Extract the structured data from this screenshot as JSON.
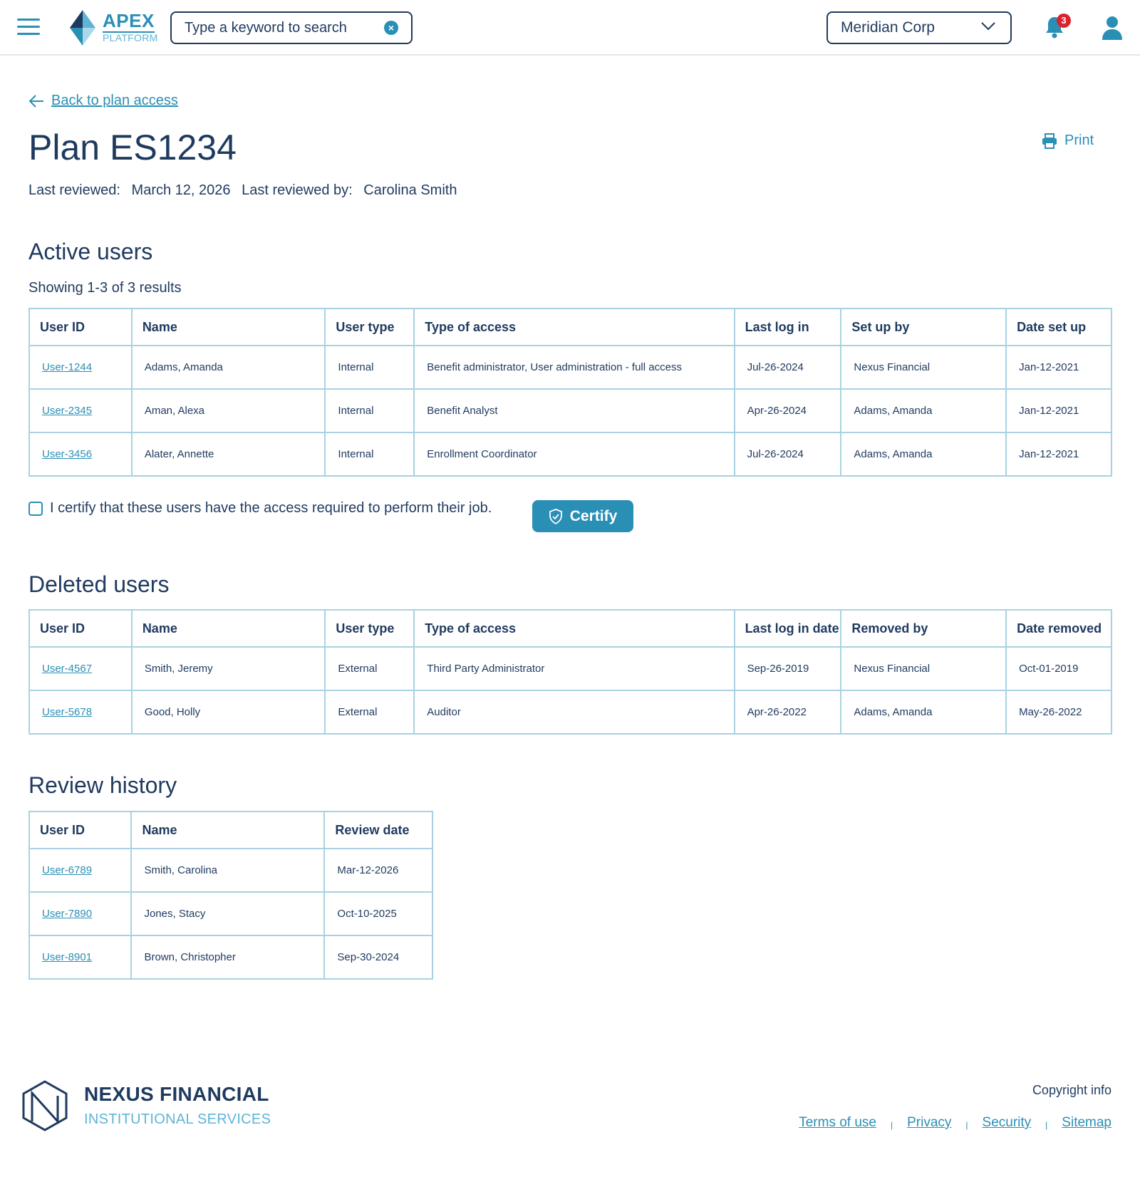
{
  "header": {
    "logo_word": "APEX",
    "logo_sub": "PLATFORM",
    "search_placeholder": "Type a keyword to search",
    "org_selected": "Meridian Corp",
    "notification_count": "3"
  },
  "page": {
    "back_label": "Back to plan access",
    "title": "Plan ES1234",
    "print_label": "Print",
    "last_reviewed_label": "Last reviewed:",
    "last_reviewed_value": "March 12, 2026",
    "last_reviewed_by_label": "Last reviewed by:",
    "last_reviewed_by_value": "Carolina Smith"
  },
  "active_users": {
    "title": "Active users",
    "results": "Showing 1-3 of 3 results",
    "columns": [
      "User ID",
      "Name",
      "User type",
      "Type of access",
      "Last log in",
      "Set up by",
      "Date set up"
    ],
    "rows": [
      [
        "User-1244",
        "Adams, Amanda",
        "Internal",
        "Benefit administrator, User administration - full access",
        "Jul-26-2024",
        "Nexus Financial",
        "Jan-12-2021"
      ],
      [
        "User-2345",
        "Aman, Alexa",
        "Internal",
        "Benefit Analyst",
        "Apr-26-2024",
        "Adams, Amanda",
        "Jan-12-2021"
      ],
      [
        "User-3456",
        "Alater, Annette",
        "Internal",
        "Enrollment Coordinator",
        "Jul-26-2024",
        "Adams, Amanda",
        "Jan-12-2021"
      ]
    ],
    "certify_text": "I certify that these users have the access required to perform their job.",
    "certify_button": "Certify"
  },
  "deleted_users": {
    "title": "Deleted users",
    "columns": [
      "User ID",
      "Name",
      "User type",
      "Type of access",
      "Last log in date",
      "Removed by",
      "Date removed"
    ],
    "rows": [
      [
        "User-4567",
        "Smith, Jeremy",
        "External",
        "Third Party Administrator",
        "Sep-26-2019",
        "Nexus Financial",
        "Oct-01-2019"
      ],
      [
        "User-5678",
        "Good, Holly",
        "External",
        "Auditor",
        "Apr-26-2022",
        "Adams, Amanda",
        "May-26-2022"
      ]
    ]
  },
  "review_history": {
    "title": "Review history",
    "columns": [
      "User ID",
      "Name",
      "Review date"
    ],
    "rows": [
      [
        "User-6789",
        "Smith, Carolina",
        "Mar-12-2026"
      ],
      [
        "User-7890",
        "Jones, Stacy",
        "Oct-10-2025"
      ],
      [
        "User-8901",
        "Brown, Christopher",
        "Sep-30-2024"
      ]
    ]
  },
  "footer": {
    "name": "NEXUS FINANCIAL",
    "sub": "INSTITUTIONAL SERVICES",
    "copyright": "Copyright info",
    "links": [
      "Terms of use",
      "Privacy",
      "Security",
      "Sitemap"
    ]
  },
  "colors": {
    "accent": "#2a8fb5",
    "text": "#1f3a5f",
    "border": "#a8d2e2",
    "badge": "#d9232e"
  }
}
